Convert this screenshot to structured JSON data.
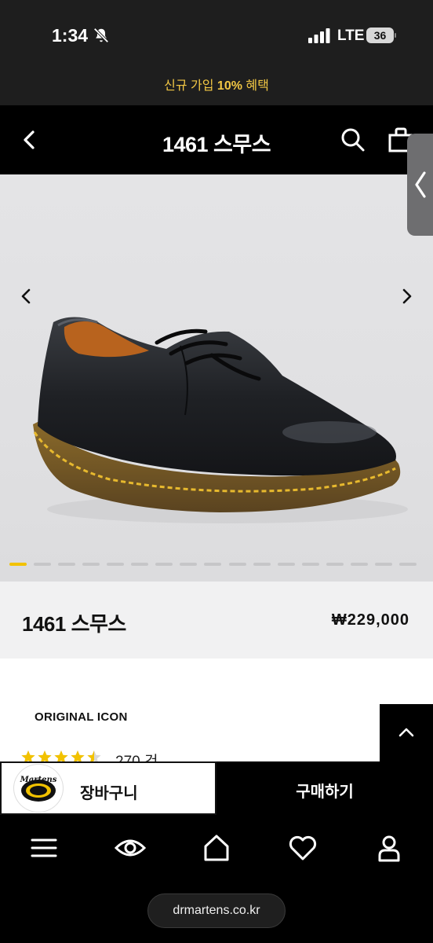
{
  "status_bar": {
    "time": "1:34",
    "network": "LTE",
    "battery": "36"
  },
  "promo": {
    "prefix": "신규 가입 ",
    "highlight": "10%",
    "suffix": " 혜택"
  },
  "header": {
    "title": "1461 스무스"
  },
  "gallery": {
    "slide_count": 17,
    "active_index": 0
  },
  "product": {
    "name": "1461 스무스",
    "price": "₩229,000",
    "collection": "ORIGINAL ICON",
    "rating": 4.5,
    "review_count": "270 건"
  },
  "actions": {
    "cart_label": "장바구니",
    "buy_label": "구매하기",
    "logo_text": "Dr. Martens AirWair"
  },
  "browser": {
    "url": "drmartens.co.kr"
  },
  "colors": {
    "promo_text": "#f2c744",
    "active_dot": "#f2c200",
    "stitching": "#e7b92e"
  },
  "icons": [
    "back-icon",
    "search-icon",
    "bag-icon",
    "menu-icon",
    "eye-icon",
    "home-icon",
    "heart-icon",
    "user-icon"
  ]
}
